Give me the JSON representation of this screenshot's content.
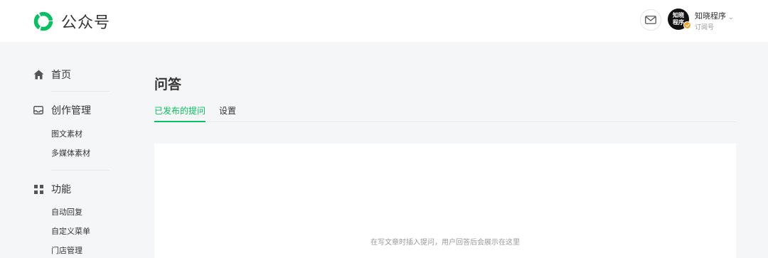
{
  "header": {
    "brand": "公众号",
    "account": {
      "name": "知晓程序",
      "type": "订阅号",
      "avatar_text_line1": "知晓",
      "avatar_text_line2": "程序"
    }
  },
  "sidebar": {
    "home": "首页",
    "creation": {
      "label": "创作管理",
      "items": [
        "图文素材",
        "多媒体素材"
      ]
    },
    "features": {
      "label": "功能",
      "items": [
        "自动回复",
        "自定义菜单",
        "门店管理"
      ]
    }
  },
  "main": {
    "title": "问答",
    "tabs": [
      {
        "label": "已发布的提问",
        "active": true
      },
      {
        "label": "设置",
        "active": false
      }
    ],
    "empty_tip": "在写文章时插入提问，用户回答后会展示在这里"
  },
  "colors": {
    "accent": "#07c160",
    "background": "#f5f6f7",
    "text": "#353535",
    "muted": "#9a9a9a"
  },
  "icons": [
    "wechat-official-logo-icon",
    "mail-icon",
    "verified-badge-icon",
    "home-icon",
    "inbox-icon",
    "grid-icon",
    "caret-down-icon"
  ]
}
